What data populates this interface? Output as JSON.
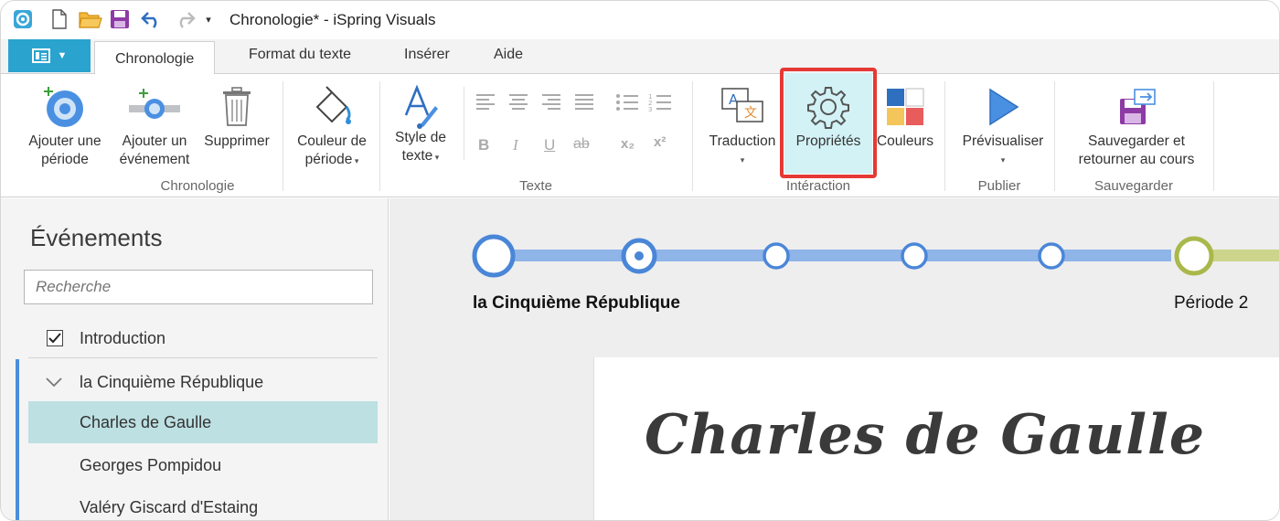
{
  "window": {
    "title": "Chronologie* - iSpring Visuals"
  },
  "ribbon_tabs": [
    {
      "label": "Chronologie",
      "active": true
    },
    {
      "label": "Format du texte",
      "active": false
    },
    {
      "label": "Insérer",
      "active": false
    },
    {
      "label": "Aide",
      "active": false
    }
  ],
  "ribbon": {
    "chronologie": {
      "add_period": "Ajouter une\npériode",
      "add_event": "Ajouter un\névénement",
      "delete": "Supprimer",
      "period_color": "Couleur de\npériode",
      "group_label": "Chronologie"
    },
    "texte": {
      "text_style": "Style de\ntexte",
      "group_label": "Texte",
      "bold": "B",
      "italic": "I",
      "underline": "U",
      "strike": "ab",
      "subscript": "x₂",
      "superscript": "x²"
    },
    "interaction": {
      "translation": "Traduction",
      "properties": "Propriétés",
      "colors": "Couleurs",
      "group_label": "Intéraction"
    },
    "publier": {
      "preview": "Prévisualiser",
      "group_label": "Publier"
    },
    "sauvegarder": {
      "save_return": "Sauvegarder et\nretourner au cours",
      "group_label": "Sauvegarder"
    }
  },
  "events_panel": {
    "title": "Événements",
    "search_placeholder": "Recherche",
    "items": [
      {
        "label": "Introduction",
        "type": "checkbox",
        "checked": true
      },
      {
        "label": "la Cinquième République",
        "type": "group",
        "expanded": true
      },
      {
        "label": "Charles de Gaulle",
        "type": "event",
        "selected": true
      },
      {
        "label": "Georges Pompidou",
        "type": "event",
        "selected": false
      },
      {
        "label": "Valéry Giscard d'Estaing",
        "type": "event",
        "selected": false
      }
    ]
  },
  "timeline": {
    "period1_label": "la Cinquième République",
    "period2_label": "Période 2"
  },
  "card": {
    "title": "Charles de Gaulle"
  },
  "colors": {
    "accent_blue": "#2aa3cf",
    "timeline_blue": "#4a86d8",
    "timeline_green": "#a9b84a",
    "highlight_red": "#e53935",
    "selected_row": "#bde0e2"
  }
}
